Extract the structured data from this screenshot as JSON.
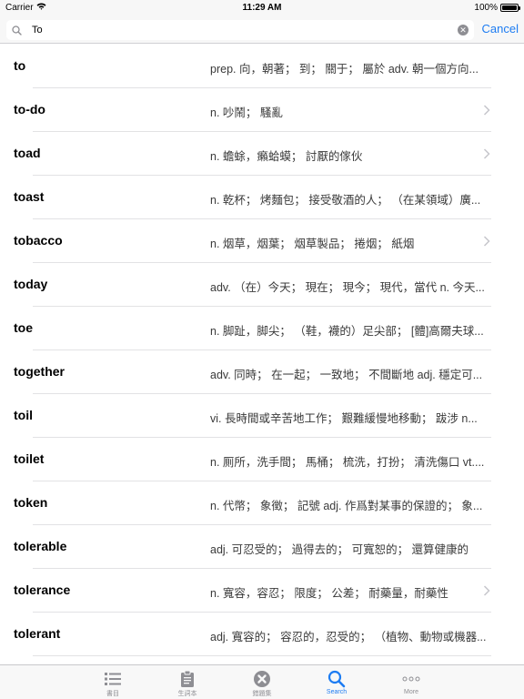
{
  "status_bar": {
    "carrier": "Carrier",
    "time": "11:29 AM",
    "battery_text": "100%",
    "battery_level": 1.0
  },
  "search": {
    "query": "To",
    "cancel_label": "Cancel"
  },
  "results": [
    {
      "word": "to",
      "definition": "prep. 向，朝著； 到； 關于； 屬於 adv. 朝一個方向...",
      "chevron": false
    },
    {
      "word": "to-do",
      "definition": "n. 吵鬧； 騷亂",
      "chevron": true
    },
    {
      "word": "toad",
      "definition": "n. 蟾蜍，癩蛤蟆； 討厭的傢伙",
      "chevron": true
    },
    {
      "word": "toast",
      "definition": "n. 乾杯； 烤麵包； 接受敬酒的人； （在某領域）廣...",
      "chevron": false
    },
    {
      "word": "tobacco",
      "definition": "n. 烟草，烟葉； 烟草製品； 捲烟； 紙烟",
      "chevron": true
    },
    {
      "word": "today",
      "definition": "adv. （在）今天； 現在； 現今； 現代，當代 n. 今天...",
      "chevron": false
    },
    {
      "word": "toe",
      "definition": "n. 脚趾，脚尖； （鞋，襪的）足尖部； [體]高爾夫球...",
      "chevron": false
    },
    {
      "word": "together",
      "definition": "adv. 同時； 在一起； 一致地； 不間斷地 adj. 穩定可...",
      "chevron": false
    },
    {
      "word": "toil",
      "definition": "vi. 長時間或辛苦地工作； 艱難緩慢地移動； 跋涉 n...",
      "chevron": false
    },
    {
      "word": "toilet",
      "definition": "n. 厠所，洗手間； 馬桶； 梳洗，打扮； 清洗傷口 vt....",
      "chevron": false
    },
    {
      "word": "token",
      "definition": "n. 代幣； 象徵； 記號 adj. 作爲對某事的保證的； 象...",
      "chevron": false
    },
    {
      "word": "tolerable",
      "definition": "adj. 可忍受的； 過得去的； 可寬恕的； 還算健康的",
      "chevron": false
    },
    {
      "word": "tolerance",
      "definition": "n. 寬容，容忍； 限度； 公差； 耐藥量，耐藥性",
      "chevron": true
    },
    {
      "word": "tolerant",
      "definition": "adj. 寬容的； 容忍的，忍受的； （植物、動物或機器...",
      "chevron": false
    }
  ],
  "tabs": [
    {
      "label": "書目",
      "icon": "list-icon",
      "active": false
    },
    {
      "label": "生詞本",
      "icon": "clipboard-icon",
      "active": false
    },
    {
      "label": "錯題集",
      "icon": "close-circle-icon",
      "active": false
    },
    {
      "label": "Search",
      "icon": "search-icon",
      "active": true
    },
    {
      "label": "More",
      "icon": "more-icon",
      "active": false
    }
  ],
  "colors": {
    "accent": "#1d7cf2",
    "inactive": "#8e8e93",
    "separator": "#e2e2e4"
  }
}
